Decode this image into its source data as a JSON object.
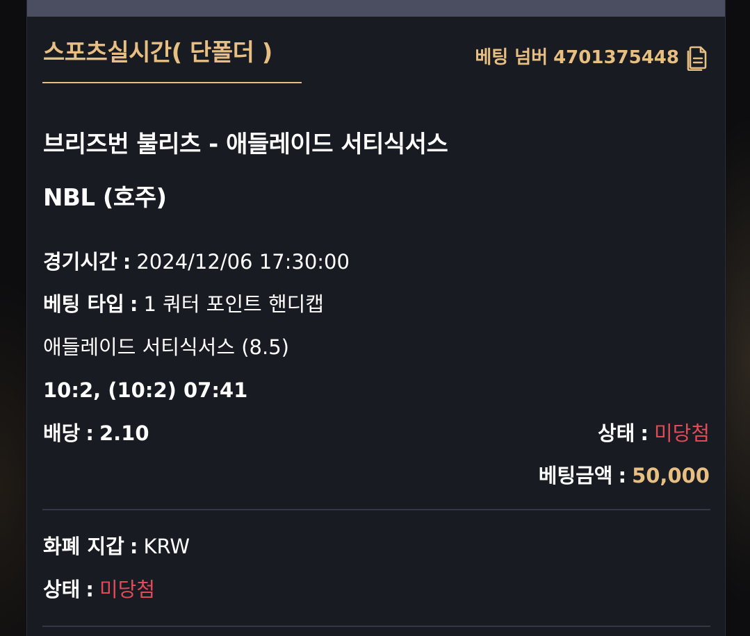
{
  "header": {
    "title": "스포츠실시간( 단폴더 )",
    "bet_number_label": "베팅 넘버",
    "bet_number": "4701375448",
    "copy_icon": "copy-document-icon"
  },
  "match": {
    "title": "브리즈번 불리츠 - 애들레이드 서티식서스",
    "league": "NBL (호주)"
  },
  "details": {
    "game_time_label": "경기시간",
    "game_time": "2024/12/06 17:30:00",
    "bet_type_label": "베팅 타입",
    "bet_type": "1 쿼터 포인트 핸디캡",
    "selection": "애들레이드 서티식서스 (8.5)",
    "score": "10:2, (10:2) 07:41",
    "odds_label": "배당",
    "odds": "2.10",
    "status_label": "상태",
    "status": "미당첨",
    "amount_label": "베팅금액",
    "amount": "50,000"
  },
  "footer": {
    "wallet_label": "화폐 지갑",
    "wallet": "KRW",
    "status_label": "상태",
    "status": "미당첨"
  },
  "colors": {
    "accent_gold": "#e8bf82",
    "status_red": "#e14a57",
    "panel_bg": "#191b22"
  }
}
